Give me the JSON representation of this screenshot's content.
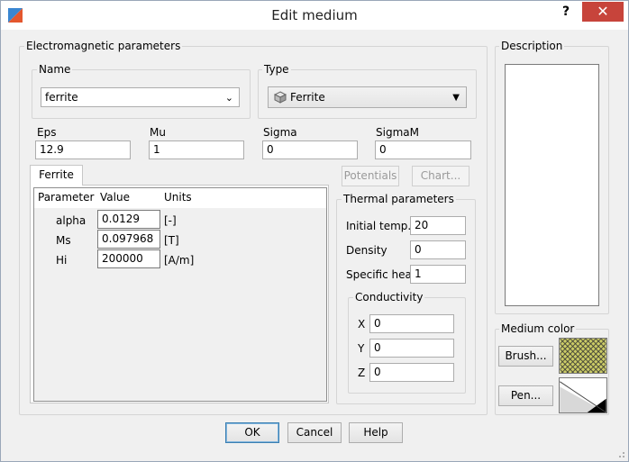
{
  "window": {
    "title": "Edit medium",
    "help": "?",
    "close": "✕"
  },
  "em_group": {
    "title": "Electromagnetic parameters",
    "name": {
      "label": "Name",
      "value": "ferrite"
    },
    "type": {
      "label": "Type",
      "value": "Ferrite"
    },
    "eps": {
      "label": "Eps",
      "value": "12.9"
    },
    "mu": {
      "label": "Mu",
      "value": "1"
    },
    "sigma": {
      "label": "Sigma",
      "value": "0"
    },
    "sigmam": {
      "label": "SigmaM",
      "value": "0"
    },
    "potentials_label": "Potentials",
    "chart_label": "Chart...",
    "tab_label": "Ferrite",
    "table": {
      "columns": [
        "Parameter",
        "Value",
        "Units"
      ],
      "rows": [
        {
          "param": "alpha",
          "value": "0.0129",
          "units": "[-]"
        },
        {
          "param": "Ms",
          "value": "0.097968",
          "units": "[T]"
        },
        {
          "param": "Hi",
          "value": "200000",
          "units": "[A/m]"
        }
      ]
    }
  },
  "thermal": {
    "title": "Thermal parameters",
    "initial_temp": {
      "label": "Initial temp.",
      "value": "20"
    },
    "density": {
      "label": "Density",
      "value": "0"
    },
    "specific_heat": {
      "label": "Specific heat",
      "value": "1"
    },
    "conductivity": {
      "title": "Conductivity",
      "x": {
        "label": "X",
        "value": "0"
      },
      "y": {
        "label": "Y",
        "value": "0"
      },
      "z": {
        "label": "Z",
        "value": "0"
      }
    }
  },
  "description": {
    "title": "Description"
  },
  "medium_color": {
    "title": "Medium color",
    "brush_label": "Brush...",
    "pen_label": "Pen..."
  },
  "footer": {
    "ok": "OK",
    "cancel": "Cancel",
    "help": "Help"
  },
  "colors": {
    "close_bg": "#c7443b",
    "brush_swatch": "#cccc66",
    "default_btn_border": "#3c7fb1"
  }
}
